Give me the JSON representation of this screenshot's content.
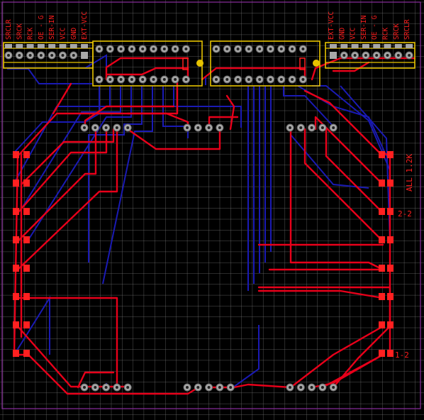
{
  "colors": {
    "background": "#000000",
    "grid": "#7b7b7b",
    "outline": "#8a2d9e",
    "top_copper": "#e8001a",
    "bottom_copper": "#1a1ab4",
    "silkscreen": "#e6c200",
    "pad": "#a8a8a8",
    "smd_pad": "#ff2020",
    "text": "#ff2a2a"
  },
  "left_header": {
    "labels": [
      "SRCLR",
      "SRCK",
      "RCK",
      "OE - G",
      "SER-IN",
      "VCC",
      "GND",
      "EXT-VCC"
    ]
  },
  "right_header": {
    "labels": [
      "EXT-VCC",
      "GND",
      "VCC",
      "SER-IN",
      "OE - G",
      "RCK",
      "SRCK",
      "SRCLR"
    ]
  },
  "annotations": {
    "all_resistors": "ALL 1.2K",
    "group_a": "2-2",
    "group_b": "1-2"
  }
}
